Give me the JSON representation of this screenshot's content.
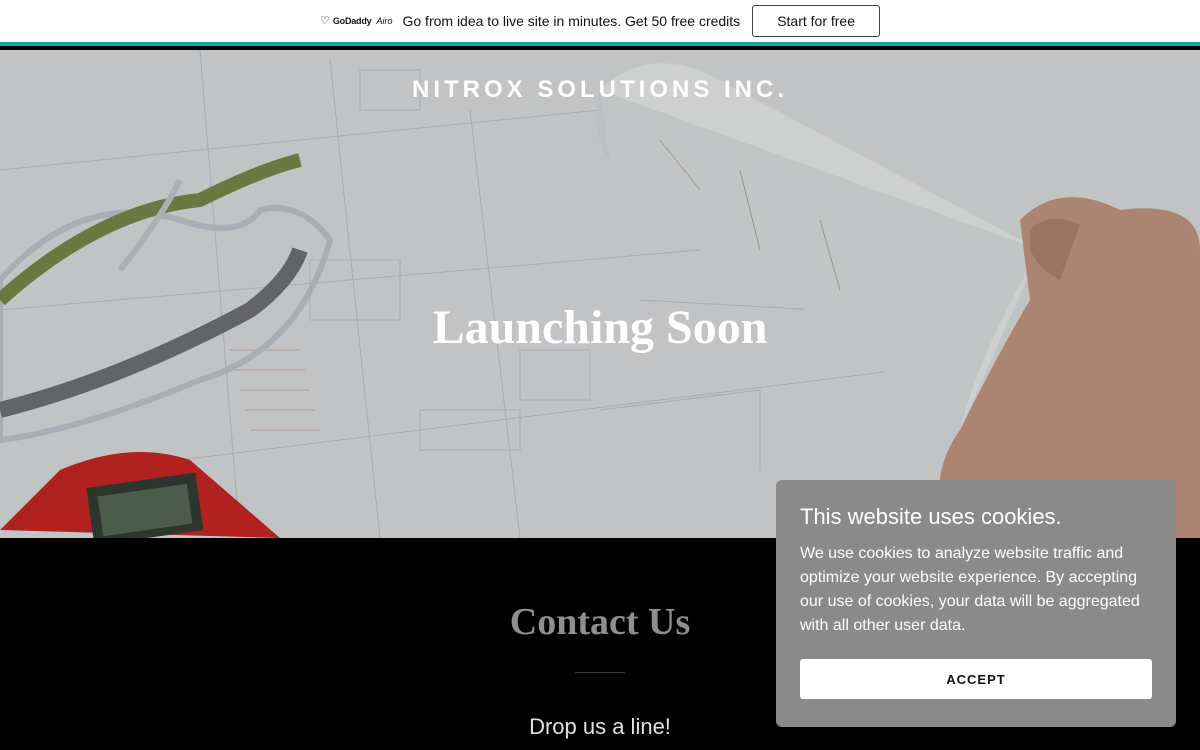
{
  "promo": {
    "brand": "GoDaddy",
    "product": "Airo",
    "message": "Go from idea to live site in minutes. Get 50 free credits",
    "button_label": "Start for free",
    "accent_color": "#1aa7a1"
  },
  "hero": {
    "site_title": "NITROX SOLUTIONS INC.",
    "heading": "Launching Soon"
  },
  "contact": {
    "title": "Contact Us",
    "subtitle": "Drop us a line!"
  },
  "cookie_banner": {
    "title": "This website uses cookies.",
    "body": "We use cookies to analyze website traffic and optimize your website experience. By accepting our use of cookies, your data will be aggregated with all other user data.",
    "accept_label": "ACCEPT"
  }
}
